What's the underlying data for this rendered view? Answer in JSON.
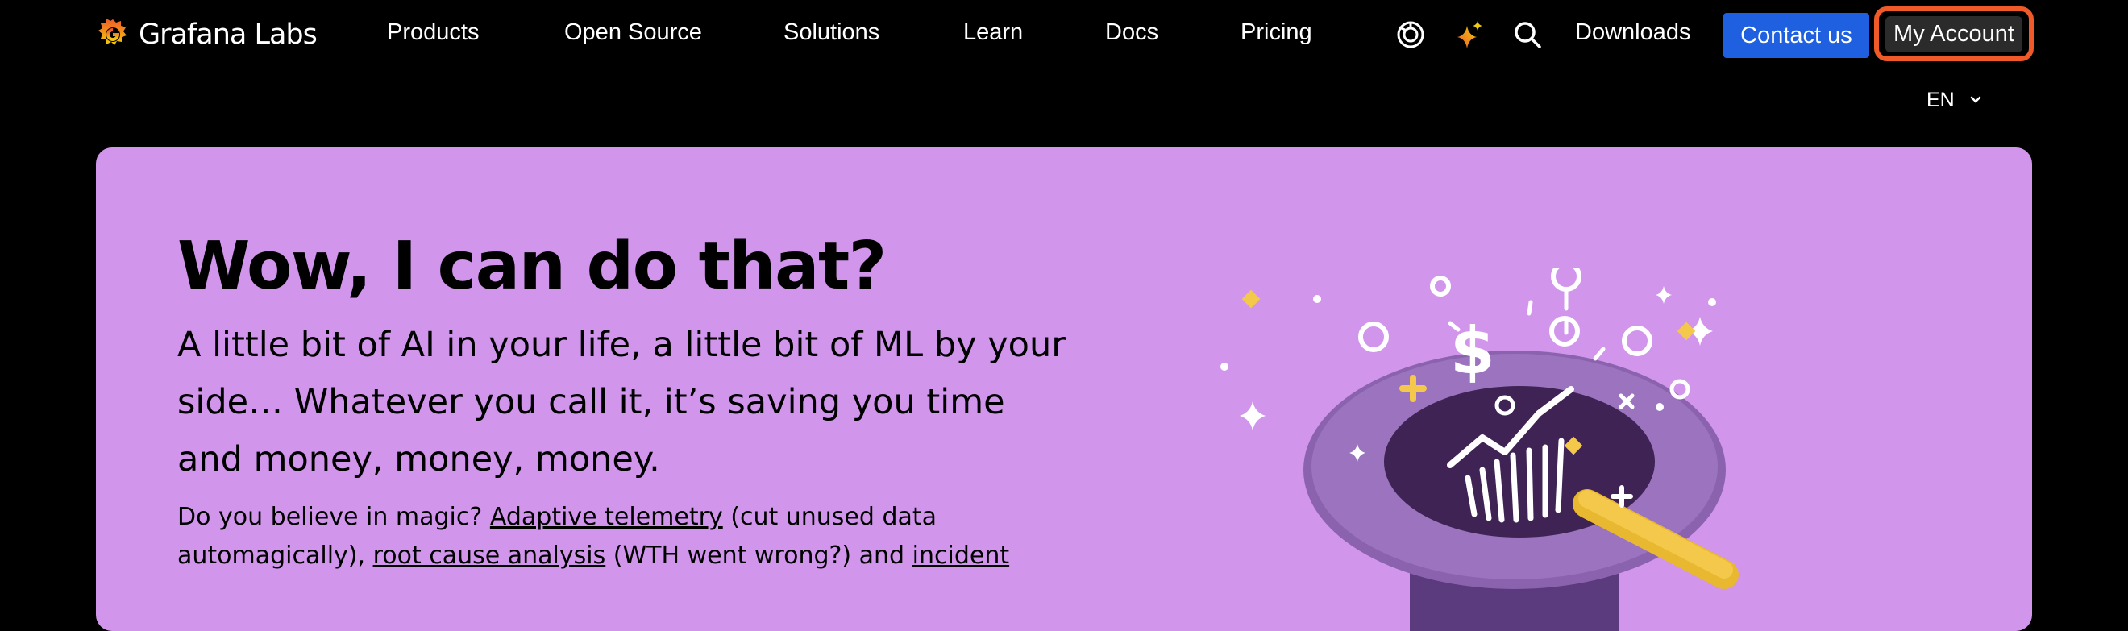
{
  "brand": {
    "name": "Grafana Labs",
    "color": "#F05A28"
  },
  "nav": {
    "links": [
      "Products",
      "Open Source",
      "Solutions",
      "Learn",
      "Docs",
      "Pricing"
    ],
    "icons": [
      "grafana-play-icon",
      "ai-sparkle-icon",
      "search-icon"
    ],
    "downloads": "Downloads",
    "contact": "Contact us",
    "account": "My Account"
  },
  "language": {
    "selected": "EN"
  },
  "hero": {
    "background": "#D295EC",
    "title": "Wow, I can do that?",
    "subtitle": "A little bit of AI in your life, a little bit of ML by your side… Whatever you call it, it’s saving you time and money, money, money.",
    "body": {
      "intro": "Do you believe in magic? ",
      "link1": "Adaptive telemetry",
      "text1": " (cut unused data automagically), ",
      "link2": "root cause analysis",
      "text2": " (WTH went wrong?) and ",
      "link3": "incident"
    }
  },
  "colors": {
    "contact_button": "#1F60E0",
    "account_outline": "#F05A28"
  }
}
